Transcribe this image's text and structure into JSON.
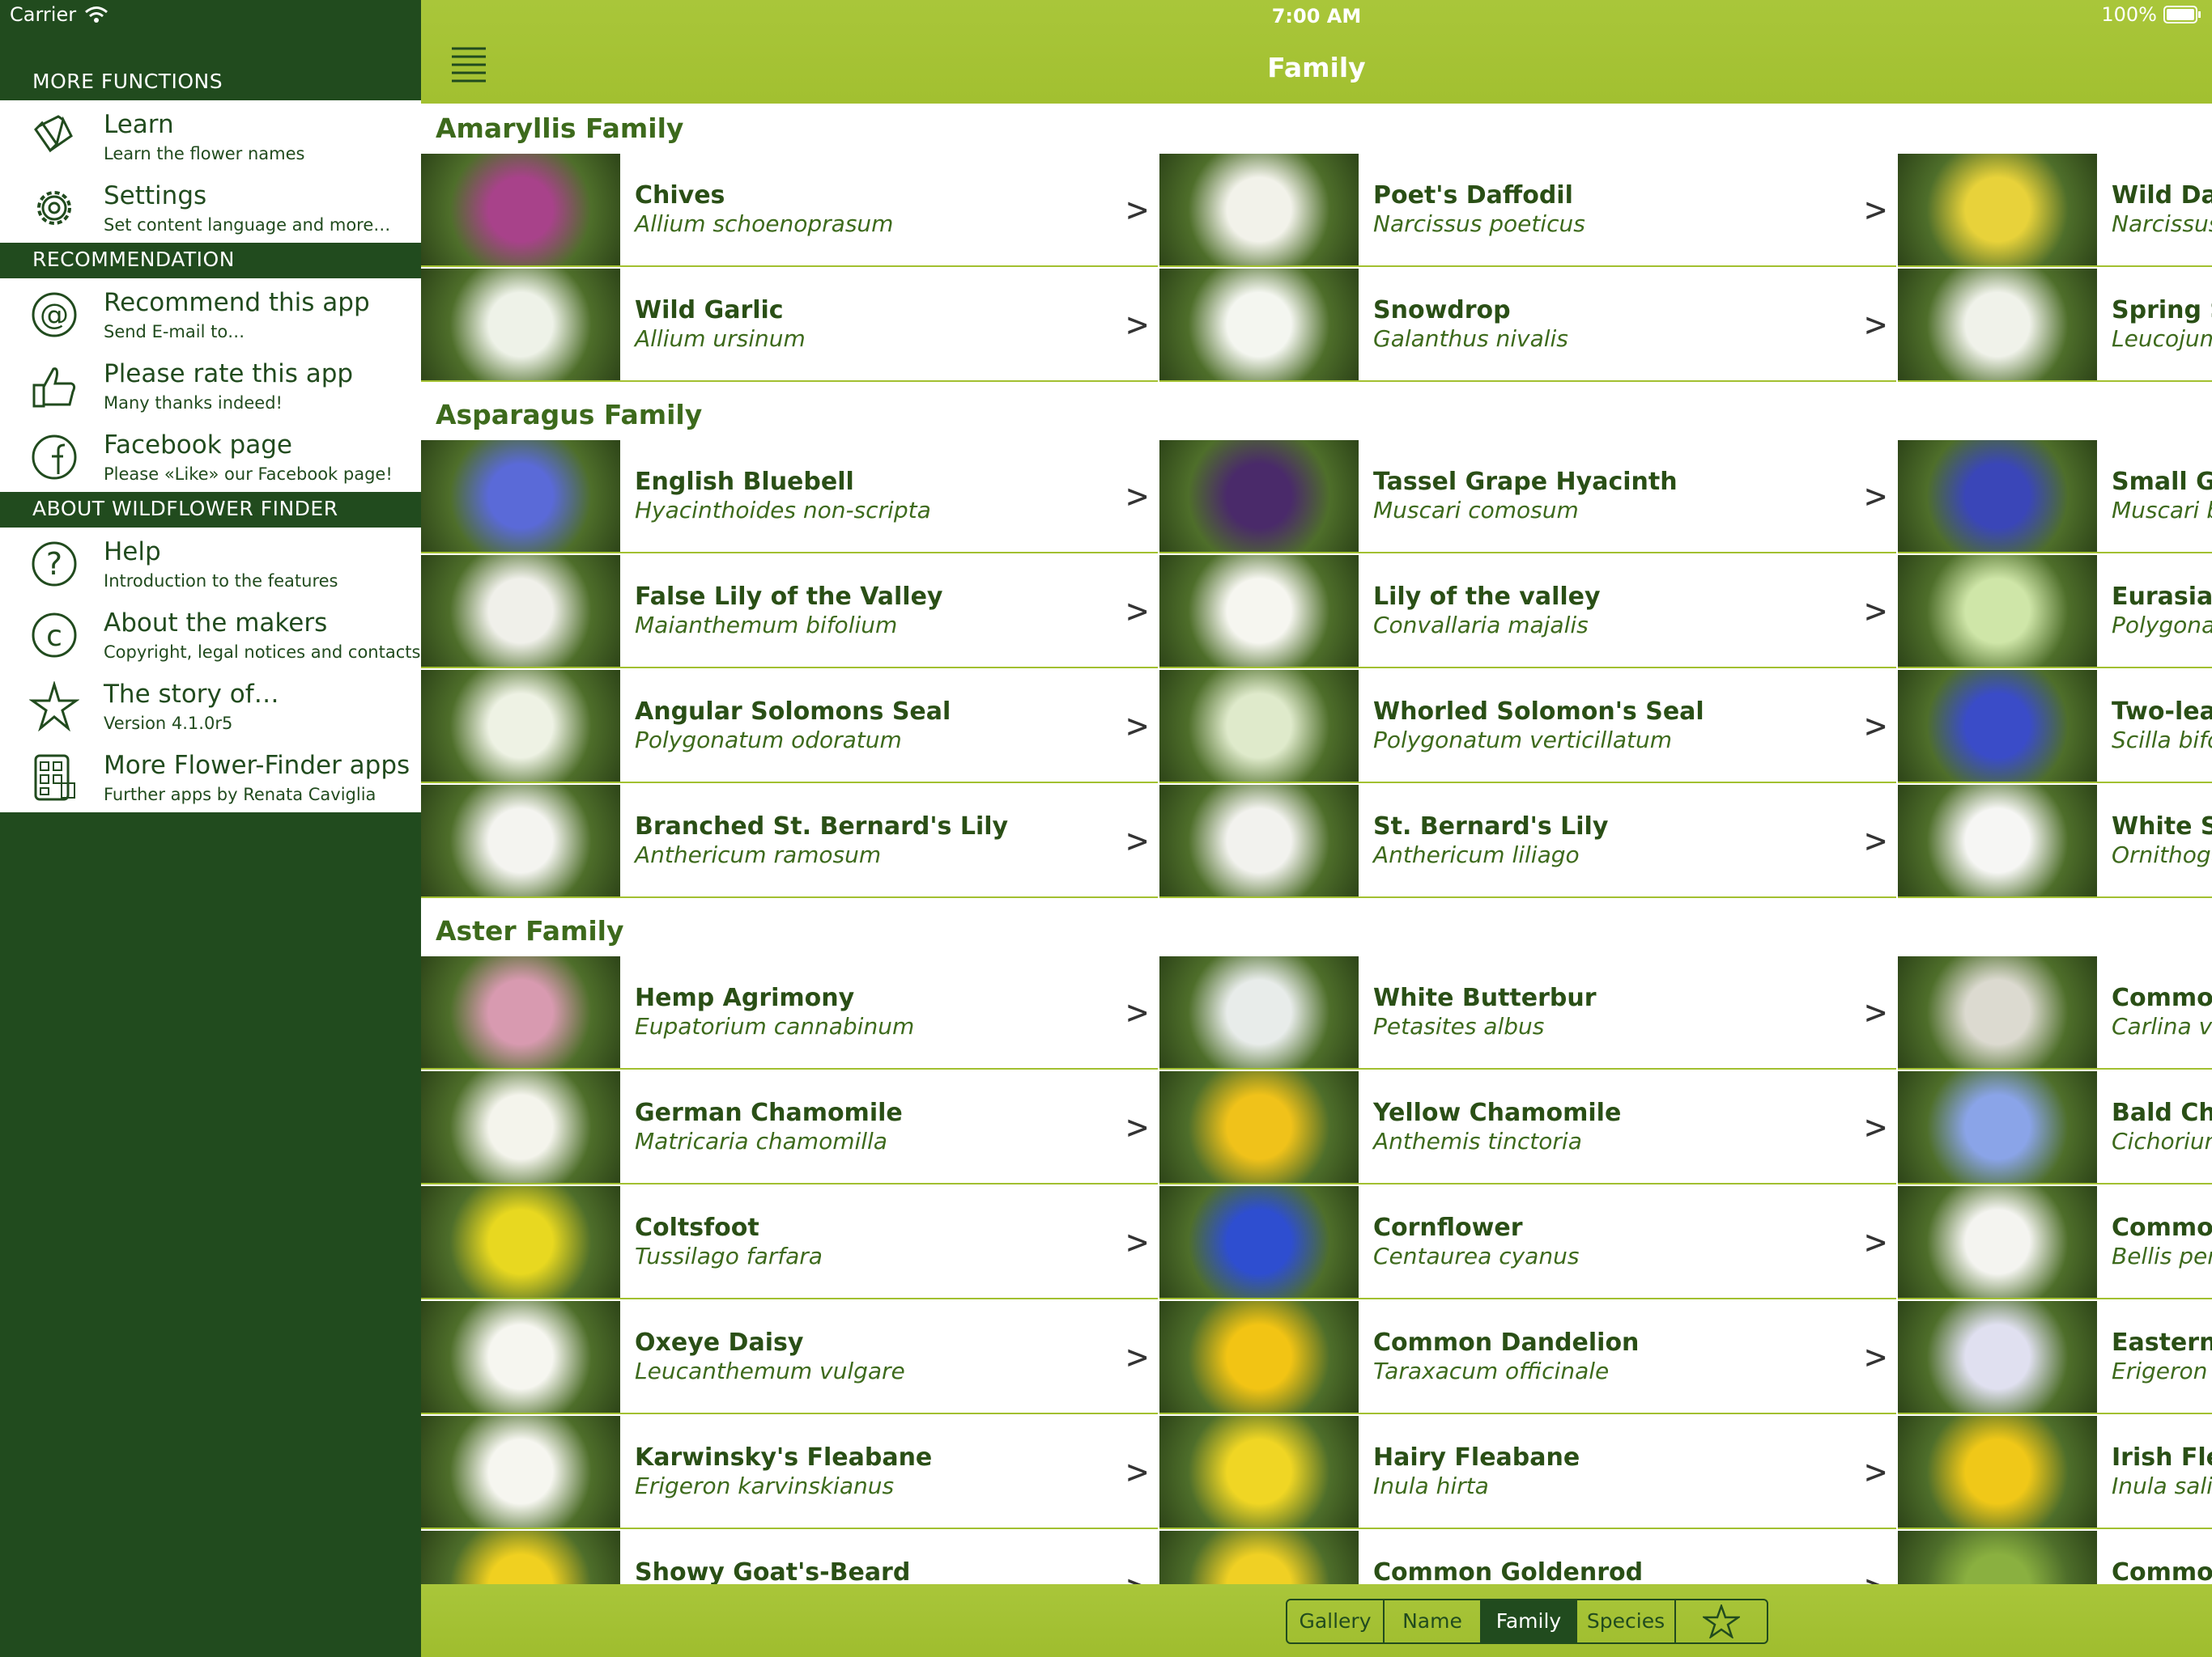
{
  "status_bar": {
    "carrier": "Carrier",
    "time": "7:00 AM",
    "battery": "100%"
  },
  "nav": {
    "title": "Family"
  },
  "sidebar": {
    "sections": [
      {
        "header": "MORE FUNCTIONS",
        "items": [
          {
            "title": "Learn",
            "subtitle": "Learn the flower names",
            "icon": "book-icon"
          },
          {
            "title": "Settings",
            "subtitle": "Set content language and more…",
            "icon": "gear-icon"
          }
        ]
      },
      {
        "header": "RECOMMENDATION",
        "items": [
          {
            "title": "Recommend this app",
            "subtitle": "Send E-mail to…",
            "icon": "at-sign-icon"
          },
          {
            "title": "Please rate this app",
            "subtitle": "Many thanks indeed!",
            "icon": "thumbs-up-icon"
          },
          {
            "title": "Facebook page",
            "subtitle": "Please «Like» our Facebook page!",
            "icon": "facebook-icon"
          }
        ]
      },
      {
        "header": "ABOUT WILDFLOWER FINDER",
        "items": [
          {
            "title": "Help",
            "subtitle": "Introduction to the features",
            "icon": "question-icon"
          },
          {
            "title": "About the makers",
            "subtitle": "Copyright, legal notices and contacts",
            "icon": "copyright-icon"
          },
          {
            "title": "The story of…",
            "subtitle": "Version 4.1.0r5",
            "icon": "star-flower-icon"
          },
          {
            "title": "More Flower-Finder apps",
            "subtitle": "Further apps by Renata Caviglia",
            "icon": "apps-icon"
          }
        ]
      }
    ]
  },
  "families": [
    {
      "name": "Amaryllis Family",
      "flowers": [
        {
          "name": "Chives",
          "latin": "Allium schoenoprasum",
          "color": "#a8428a"
        },
        {
          "name": "Poet's Daffodil",
          "latin": "Narcissus poeticus",
          "color": "#f2f2ea"
        },
        {
          "name": "Wild Daf",
          "latin": "Narcissus",
          "color": "#e8d23a"
        },
        {
          "name": "Wild Garlic",
          "latin": "Allium ursinum",
          "color": "#eef2e8"
        },
        {
          "name": "Snowdrop",
          "latin": "Galanthus nivalis",
          "color": "#f4f6f0"
        },
        {
          "name": "Spring Sn",
          "latin": "Leucojum",
          "color": "#f0f2ea"
        }
      ]
    },
    {
      "name": "Asparagus Family",
      "flowers": [
        {
          "name": "English Bluebell",
          "latin": "Hyacinthoides non-scripta",
          "color": "#5a6ad8"
        },
        {
          "name": "Tassel Grape Hyacinth",
          "latin": "Muscari comosum",
          "color": "#4a2a6a"
        },
        {
          "name": "Small Gra",
          "latin": "Muscari b",
          "color": "#3a46b8"
        },
        {
          "name": "False Lily of the Valley",
          "latin": "Maianthemum bifolium",
          "color": "#f0f0ea"
        },
        {
          "name": "Lily of the valley",
          "latin": "Convallaria majalis",
          "color": "#f6f6f0"
        },
        {
          "name": "Eurasian",
          "latin": "Polygona",
          "color": "#cfe6a8"
        },
        {
          "name": "Angular Solomons Seal",
          "latin": "Polygonatum odoratum",
          "color": "#eef2e4"
        },
        {
          "name": "Whorled Solomon's Seal",
          "latin": "Polygonatum verticillatum",
          "color": "#dfeacb"
        },
        {
          "name": "Two-leaf",
          "latin": "Scilla bifo",
          "color": "#3a4cc8"
        },
        {
          "name": "Branched St. Bernard's Lily",
          "latin": "Anthericum ramosum",
          "color": "#f4f4f0"
        },
        {
          "name": "St. Bernard's Lily",
          "latin": "Anthericum liliago",
          "color": "#f2f2ee"
        },
        {
          "name": "White St",
          "latin": "Ornithoga",
          "color": "#f6f6f4"
        }
      ]
    },
    {
      "name": "Aster Family",
      "flowers": [
        {
          "name": "Hemp Agrimony",
          "latin": "Eupatorium cannabinum",
          "color": "#d89ab0"
        },
        {
          "name": "White Butterbur",
          "latin": "Petasites albus",
          "color": "#e8ecea"
        },
        {
          "name": "Common",
          "latin": "Carlina vu",
          "color": "#dcdad0"
        },
        {
          "name": "German Chamomile",
          "latin": "Matricaria chamomilla",
          "color": "#f4f4ec"
        },
        {
          "name": "Yellow Chamomile",
          "latin": "Anthemis tinctoria",
          "color": "#f0c21a"
        },
        {
          "name": "Bald Chic",
          "latin": "Cichoriun",
          "color": "#8aa4e8"
        },
        {
          "name": "Coltsfoot",
          "latin": "Tussilago farfara",
          "color": "#e8d820"
        },
        {
          "name": "Cornflower",
          "latin": "Centaurea cyanus",
          "color": "#2e4ed0"
        },
        {
          "name": "Common",
          "latin": "Bellis pere",
          "color": "#f4f4f0"
        },
        {
          "name": "Oxeye Daisy",
          "latin": "Leucanthemum vulgare",
          "color": "#f6f6f0"
        },
        {
          "name": "Common Dandelion",
          "latin": "Taraxacum officinale",
          "color": "#f2c414"
        },
        {
          "name": "Eastern I",
          "latin": "Erigeron a",
          "color": "#e0e0f0"
        },
        {
          "name": "Karwinsky's Fleabane",
          "latin": "Erigeron karvinskianus",
          "color": "#f6f6f0"
        },
        {
          "name": "Hairy Fleabane",
          "latin": "Inula hirta",
          "color": "#f0d624"
        },
        {
          "name": "Irish Flea",
          "latin": "Inula salic",
          "color": "#f0c818"
        },
        {
          "name": "Showy Goat's-Beard",
          "latin": "",
          "color": "#f0d020"
        },
        {
          "name": "Common Goldenrod",
          "latin": "",
          "color": "#f0d024"
        },
        {
          "name": "Common",
          "latin": "",
          "color": "#8ab040"
        }
      ]
    }
  ],
  "tabs": [
    {
      "label": "Gallery",
      "active": false
    },
    {
      "label": "Name",
      "active": false
    },
    {
      "label": "Family",
      "active": true
    },
    {
      "label": "Species",
      "active": false
    },
    {
      "label": "",
      "active": false,
      "icon": "favorites-star-icon"
    }
  ]
}
